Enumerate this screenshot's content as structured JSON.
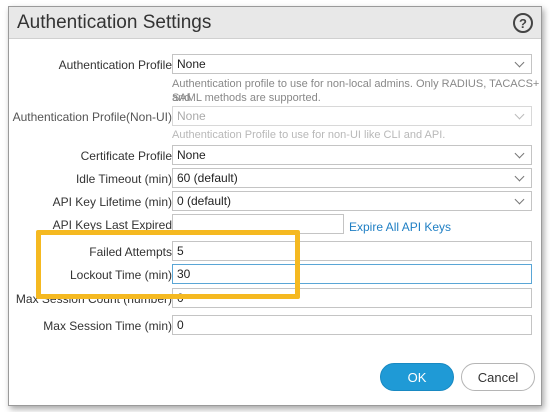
{
  "dialog": {
    "title": "Authentication Settings",
    "help_icon": "question-circle-icon"
  },
  "fields": {
    "auth_profile": {
      "label": "Authentication Profile",
      "value": "None",
      "help": "Authentication profile to use for non-local admins. Only RADIUS, TACACS+ and",
      "help2": "SAML methods are supported."
    },
    "auth_profile_nonui": {
      "label": "Authentication Profile(Non-UI)",
      "value": "None",
      "help": "Authentication Profile to use for non-UI like CLI and API."
    },
    "cert_profile": {
      "label": "Certificate Profile",
      "value": "None"
    },
    "idle_timeout": {
      "label": "Idle Timeout (min)",
      "value": "60 (default)"
    },
    "api_key_lifetime": {
      "label": "API Key Lifetime (min)",
      "value": "0 (default)"
    },
    "api_keys_last_expired": {
      "label": "API Keys Last Expired",
      "value": "",
      "link": "Expire All API Keys"
    },
    "failed_attempts": {
      "label": "Failed Attempts",
      "value": "5"
    },
    "lockout_time": {
      "label": "Lockout Time (min)",
      "value": "30"
    },
    "max_session_count": {
      "label": "Max Session Count (number)",
      "value": "0"
    },
    "max_session_time": {
      "label": "Max Session Time (min)",
      "value": "0"
    }
  },
  "buttons": {
    "ok": "OK",
    "cancel": "Cancel"
  },
  "colors": {
    "accent": "#1f9ad6",
    "highlight": "#f5b921",
    "link": "#1f7fc4"
  }
}
